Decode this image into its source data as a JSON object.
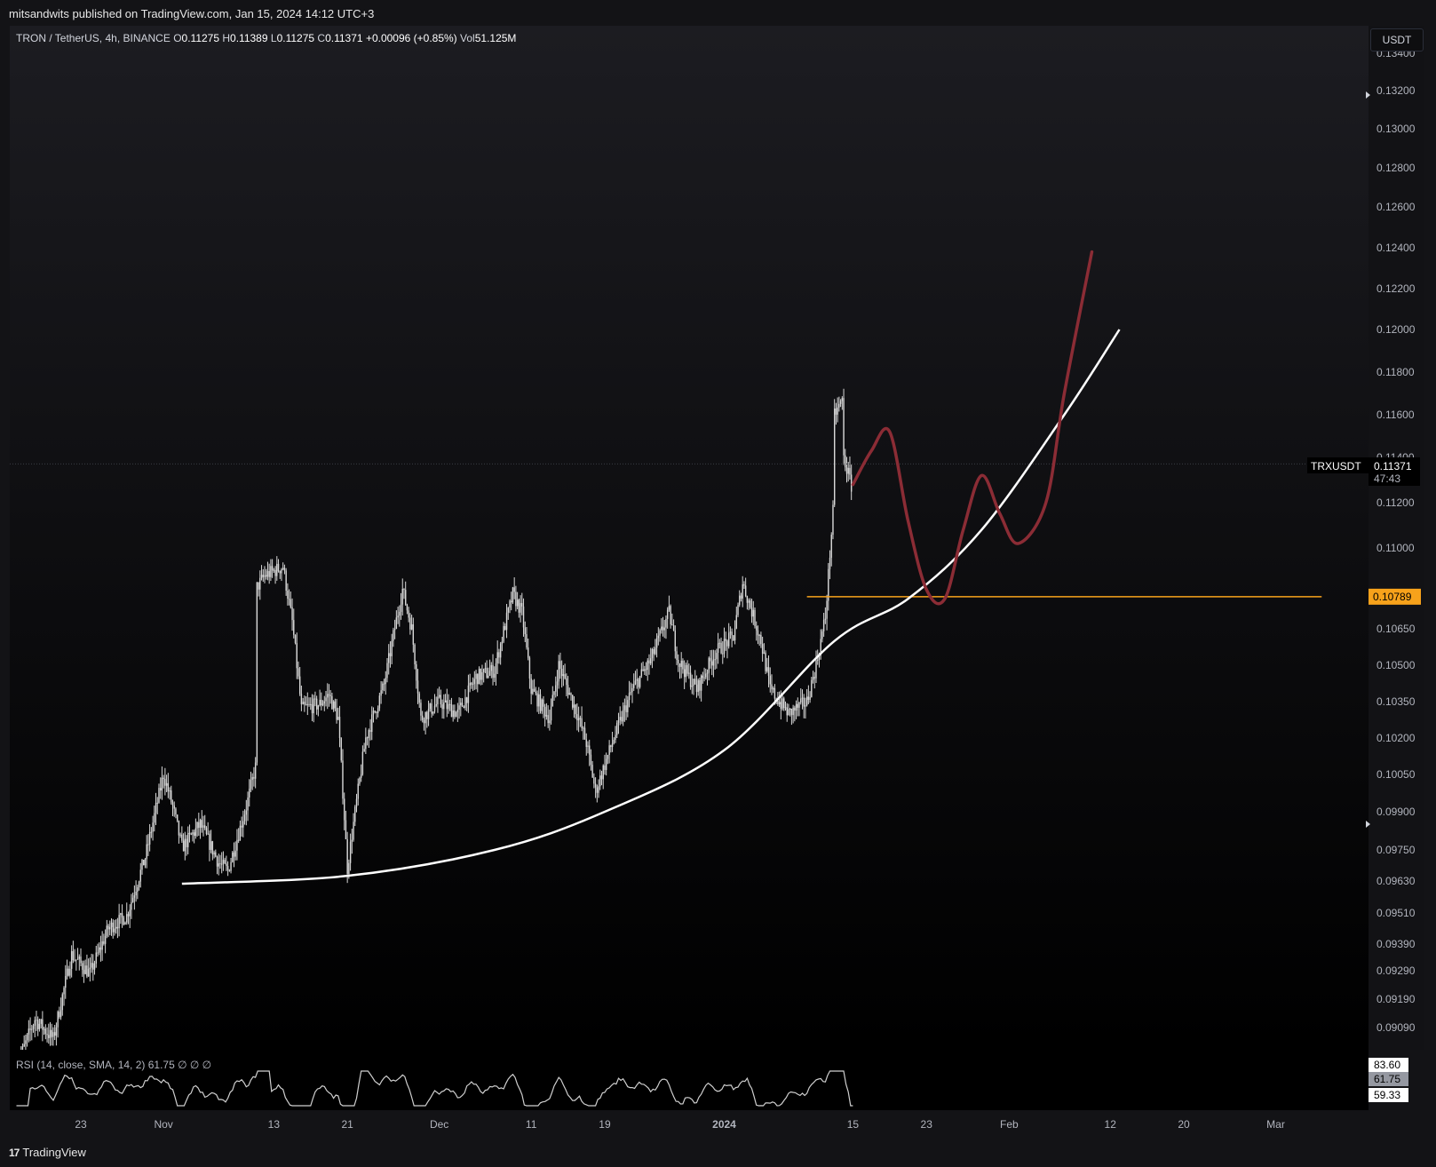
{
  "header": {
    "published": "mitsandwits published on TradingView.com, Jan 15, 2024 14:12 UTC+3"
  },
  "legend": {
    "symbol": "TRON / TetherUS, 4h, BINANCE",
    "o_label": "O",
    "o_value": "0.11275",
    "h_label": "H",
    "h_value": "0.11389",
    "l_label": "L",
    "l_value": "0.11275",
    "c_label": "C",
    "c_value": "0.11371",
    "change": "+0.00096 (+0.85%)",
    "vol_label": "Vol",
    "vol_value": "51.125M"
  },
  "currency_button": "USDT",
  "rsi": {
    "legend": "RSI (14, close, SMA, 14, 2)  61.75  ∅  ∅  ∅",
    "labels": [
      "83.60",
      "61.75",
      "59.33"
    ]
  },
  "footer": {
    "brand": "TradingView",
    "logo": "17"
  },
  "colors": {
    "background_top": "#18181c",
    "background_bottom": "#000000",
    "candle": "#d8d8d8",
    "curve": "#ffffff",
    "projection": "#8b2c35",
    "level_line": "#f7a21b",
    "rsi_line": "#cfcfcf"
  },
  "chart_data": {
    "type": "candlestick",
    "symbol_tag": "TRXUSDT",
    "last_price": "0.11371",
    "countdown": "47:43",
    "level_label": "0.10789",
    "level_value": 0.10789,
    "y_ticks": [
      0.134,
      0.132,
      0.13,
      0.128,
      0.126,
      0.124,
      0.122,
      0.12,
      0.118,
      0.116,
      0.114,
      0.112,
      0.11,
      0.1065,
      0.105,
      0.1035,
      0.102,
      0.1005,
      0.099,
      0.0975,
      0.0963,
      0.0951,
      0.0939,
      0.0929,
      0.0919,
      0.0909
    ],
    "y_tick_labels": [
      "0.13400",
      "0.13200",
      "0.13000",
      "0.12800",
      "0.12600",
      "0.12400",
      "0.12200",
      "0.12000",
      "0.11800",
      "0.11600",
      "0.11400",
      "0.11200",
      "0.11000",
      "0.10650",
      "0.10500",
      "0.10350",
      "0.10200",
      "0.10050",
      "0.09900",
      "0.09750",
      "0.09630",
      "0.09510",
      "0.09390",
      "0.09290",
      "0.09190",
      "0.09090"
    ],
    "x_ticks": [
      "23",
      "Nov",
      "13",
      "21",
      "Dec",
      "11",
      "19",
      "2024",
      "15",
      "23",
      "Feb",
      "12",
      "20",
      "Mar"
    ],
    "x_tick_dates": [
      "2023-10-23",
      "2023-11-01",
      "2023-11-13",
      "2023-11-21",
      "2023-12-01",
      "2023-12-11",
      "2023-12-19",
      "2024-01-01",
      "2024-01-15",
      "2024-01-23",
      "2024-02-01",
      "2024-02-12",
      "2024-02-20",
      "2024-03-01"
    ],
    "price_path": [
      [
        "2023-10-16",
        0.0895
      ],
      [
        "2023-10-18",
        0.0912
      ],
      [
        "2023-10-20",
        0.0905
      ],
      [
        "2023-10-22",
        0.0935
      ],
      [
        "2023-10-24",
        0.0928
      ],
      [
        "2023-10-26",
        0.0945
      ],
      [
        "2023-10-28",
        0.095
      ],
      [
        "2023-10-30",
        0.0972
      ],
      [
        "2023-11-01",
        0.1005
      ],
      [
        "2023-11-02",
        0.0992
      ],
      [
        "2023-11-03",
        0.0976
      ],
      [
        "2023-11-05",
        0.0985
      ],
      [
        "2023-11-07",
        0.097
      ],
      [
        "2023-11-08",
        0.0967
      ],
      [
        "2023-11-10",
        0.0992
      ],
      [
        "2023-11-11",
        0.1008
      ],
      [
        "2023-11-11",
        0.1082
      ],
      [
        "2023-11-12",
        0.1088
      ],
      [
        "2023-11-14",
        0.1092
      ],
      [
        "2023-11-15",
        0.1068
      ],
      [
        "2023-11-16",
        0.1032
      ],
      [
        "2023-11-18",
        0.1034
      ],
      [
        "2023-11-19",
        0.1038
      ],
      [
        "2023-11-20",
        0.1028
      ],
      [
        "2023-11-21",
        0.0968
      ],
      [
        "2023-11-23",
        0.102
      ],
      [
        "2023-11-25",
        0.1042
      ],
      [
        "2023-11-27",
        0.1082
      ],
      [
        "2023-11-28",
        0.1065
      ],
      [
        "2023-11-29",
        0.1028
      ],
      [
        "2023-12-01",
        0.1035
      ],
      [
        "2023-12-03",
        0.103
      ],
      [
        "2023-12-05",
        0.1045
      ],
      [
        "2023-12-07",
        0.1048
      ],
      [
        "2023-12-09",
        0.108
      ],
      [
        "2023-12-10",
        0.1072
      ],
      [
        "2023-12-11",
        0.104
      ],
      [
        "2023-12-13",
        0.1028
      ],
      [
        "2023-12-14",
        0.105
      ],
      [
        "2023-12-16",
        0.103
      ],
      [
        "2023-12-17",
        0.1018
      ],
      [
        "2023-12-18",
        0.0998
      ],
      [
        "2023-12-20",
        0.102
      ],
      [
        "2023-12-22",
        0.104
      ],
      [
        "2023-12-24",
        0.1052
      ],
      [
        "2023-12-26",
        0.1072
      ],
      [
        "2023-12-27",
        0.1052
      ],
      [
        "2023-12-29",
        0.104
      ],
      [
        "2023-12-31",
        0.1055
      ],
      [
        "2024-01-02",
        0.1062
      ],
      [
        "2024-01-03",
        0.1085
      ],
      [
        "2024-01-05",
        0.106
      ],
      [
        "2024-01-06",
        0.104
      ],
      [
        "2024-01-08",
        0.103
      ],
      [
        "2024-01-10",
        0.1035
      ],
      [
        "2024-01-11",
        0.105
      ],
      [
        "2024-01-12",
        0.107
      ],
      [
        "2024-01-13",
        0.1125
      ],
      [
        "2024-01-13",
        0.116
      ],
      [
        "2024-01-14",
        0.1168
      ],
      [
        "2024-01-14",
        0.114
      ],
      [
        "2024-01-15",
        0.1125
      ],
      [
        "2024-01-15",
        0.11371
      ]
    ],
    "support_curve": [
      [
        "2023-11-03",
        0.0962
      ],
      [
        "2023-11-21",
        0.0965
      ],
      [
        "2023-12-07",
        0.0975
      ],
      [
        "2023-12-19",
        0.099
      ],
      [
        "2024-01-01",
        0.1015
      ],
      [
        "2024-01-13",
        0.106
      ],
      [
        "2024-01-21",
        0.1078
      ],
      [
        "2024-01-29",
        0.1108
      ],
      [
        "2024-02-07",
        0.116
      ],
      [
        "2024-02-13",
        0.12
      ]
    ],
    "projection_path": [
      [
        "2024-01-15",
        0.1128
      ],
      [
        "2024-01-17",
        0.1143
      ],
      [
        "2024-01-19",
        0.1152
      ],
      [
        "2024-01-21",
        0.1112
      ],
      [
        "2024-01-23",
        0.1082
      ],
      [
        "2024-01-25",
        0.1078
      ],
      [
        "2024-01-27",
        0.1108
      ],
      [
        "2024-01-29",
        0.1132
      ],
      [
        "2024-01-31",
        0.1115
      ],
      [
        "2024-02-02",
        0.1102
      ],
      [
        "2024-02-05",
        0.112
      ],
      [
        "2024-02-07",
        0.117
      ],
      [
        "2024-02-10",
        0.1238
      ]
    ],
    "level_line_range": [
      "2024-01-10",
      "2024-03-06"
    ]
  }
}
